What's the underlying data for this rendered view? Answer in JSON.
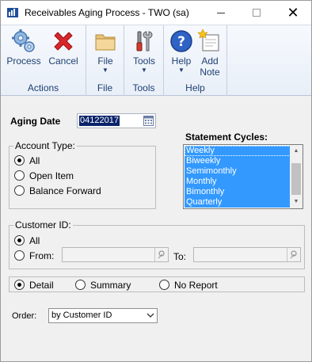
{
  "window": {
    "title": "Receivables Aging Process  -  TWO (sa)",
    "icon": "dynamics-app-icon"
  },
  "ribbon": {
    "groups": [
      {
        "label": "Actions",
        "buttons": [
          {
            "label": "Process",
            "icon": "gears-icon"
          },
          {
            "label": "Cancel",
            "icon": "red-x-icon"
          }
        ]
      },
      {
        "label": "File",
        "buttons": [
          {
            "label": "File",
            "icon": "folder-icon",
            "has_dropdown": true
          }
        ]
      },
      {
        "label": "Tools",
        "buttons": [
          {
            "label": "Tools",
            "icon": "tools-icon",
            "has_dropdown": true
          }
        ]
      },
      {
        "label": "Help",
        "buttons": [
          {
            "label": "Help",
            "icon": "help-icon",
            "has_dropdown": true
          },
          {
            "label": "Add Note",
            "icon": "add-note-icon"
          }
        ]
      }
    ],
    "add_note_line1": "Add",
    "add_note_line2": "Note"
  },
  "aging_date": {
    "label": "Aging Date",
    "value": "04122017"
  },
  "account_type": {
    "legend": "Account Type:",
    "options": [
      "All",
      "Open Item",
      "Balance Forward"
    ],
    "selected": "All"
  },
  "statement_cycles": {
    "label": "Statement Cycles:",
    "items": [
      "Weekly",
      "Biweekly",
      "Semimonthly",
      "Monthly",
      "Bimonthly",
      "Quarterly"
    ]
  },
  "customer_id": {
    "legend": "Customer ID:",
    "options": [
      "All",
      "From:"
    ],
    "selected": "All",
    "to_label": "To:",
    "from_value": "",
    "to_value": ""
  },
  "report_type": {
    "options": [
      "Detail",
      "Summary",
      "No Report"
    ],
    "selected": "Detail"
  },
  "order": {
    "label": "Order:",
    "value": "by Customer ID"
  },
  "colors": {
    "selection": "#3399ff",
    "ribbon_text": "#1e3f73"
  }
}
